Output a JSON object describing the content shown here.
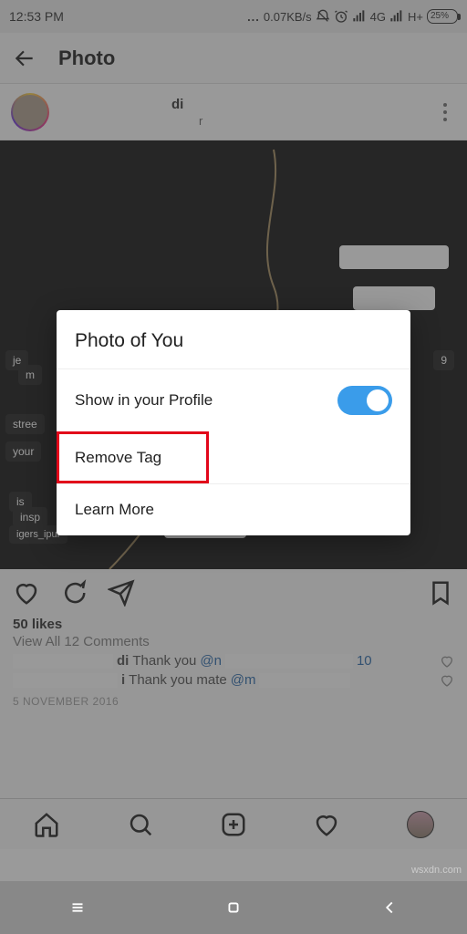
{
  "statusbar": {
    "time": "12:53 PM",
    "speed": "0.07KB/s",
    "net1": "4G",
    "net2": "H+",
    "battery": "25%"
  },
  "header": {
    "title": "Photo"
  },
  "post": {
    "username_suffix": "di",
    "subtitle_suffix": "r"
  },
  "actions": {
    "likes": "50 likes",
    "view_comments": "View All 12 Comments",
    "c1_name_suffix": "di",
    "c1_text": "Thank you ",
    "c1_mention": "@n",
    "c1_tail": "10",
    "c2_name_suffix": "i",
    "c2_text": "Thank you mate ",
    "c2_mention": "@m",
    "date": "5 NOVEMBER 2016"
  },
  "modal": {
    "title": "Photo of You",
    "row1": "Show in your Profile",
    "row2": "Remove Tag",
    "row3": "Learn More"
  },
  "watermark": "wsxdn.com"
}
